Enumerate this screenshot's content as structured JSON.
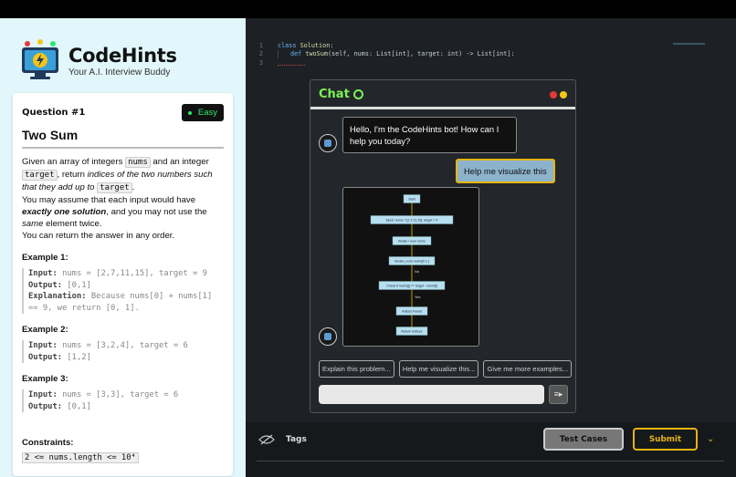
{
  "brand": {
    "name": "CodeHints",
    "tagline": "Your A.I. Interview Buddy"
  },
  "question": {
    "number": "Question #1",
    "difficulty": "Easy",
    "title": "Two Sum",
    "desc": {
      "p1_a": "Given an array of integers ",
      "p1_code1": "nums",
      "p1_b": " and an integer ",
      "p1_code2": "target",
      "p1_c": ", return ",
      "p1_em": "indices of the two numbers such that they add up to",
      "p1_code3": "target",
      "p1_d": ".",
      "p2_a": "You may assume that each input would have ",
      "p2_strong": "exactly one solution",
      "p2_b": ", and you may not use the ",
      "p2_em": "same",
      "p2_c": " element twice.",
      "p3": "You can return the answer in any order."
    },
    "examples": [
      {
        "title": "Example 1:",
        "input": "nums = [2,7,11,15], target = 9",
        "output": "[0,1]",
        "explanation": "Because nums[0] + nums[1] == 9, we return [0, 1]."
      },
      {
        "title": "Example 2:",
        "input": "nums = [3,2,4], target = 6",
        "output": "[1,2]"
      },
      {
        "title": "Example 3:",
        "input": "nums = [3,3], target = 6",
        "output": "[0,1]"
      }
    ],
    "labels": {
      "input": "Input:",
      "output": "Output:",
      "explanation": "Explanation:"
    },
    "constraints_title": "Constraints:",
    "constraints": [
      "2 <= nums.length <= 10⁴"
    ]
  },
  "editor": {
    "lines": [
      {
        "num": "1",
        "kw": "class",
        "name": "Solution",
        "rest": ":"
      },
      {
        "num": "2",
        "kw": "def",
        "name": "twoSum",
        "rest": "(self, nums: List[int], target: int) -> List[int]:"
      },
      {
        "num": "3",
        "kw": "",
        "name": "",
        "rest": ""
      }
    ]
  },
  "chat": {
    "title": "Chat",
    "bot_message": "Hello, I'm the CodeHints bot! How can I help you today?",
    "user_message": "Help me visualize this",
    "flowchart": {
      "nodes": [
        "Start",
        "Input: nums = [2,7,11,15], target = 9",
        "Iterate i over nums",
        "Iterate j over nums[i+1:]",
        "Check if nums[j] == target - nums[i]",
        "Indices Found",
        "Return Indices"
      ],
      "edge_labels": [
        "No",
        "Yes"
      ]
    },
    "suggestions": [
      "Explain this problem...",
      "Help me visualize this...",
      "Give me more examples..."
    ],
    "input_placeholder": "",
    "colors": {
      "accent": "#7cf255",
      "dot_red": "#e53935",
      "dot_yellow": "#f5c518",
      "highlight": "#e5b513"
    }
  },
  "bottom": {
    "tags_label": "Tags",
    "test_cases": "Test Cases",
    "submit": "Submit"
  }
}
